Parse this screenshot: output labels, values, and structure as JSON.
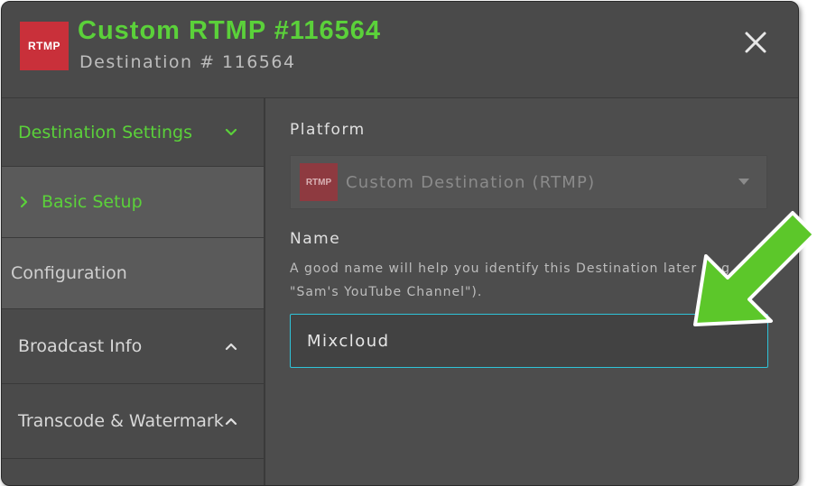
{
  "header": {
    "logo_text": "RTMP",
    "title": "Custom RTMP #116564",
    "subtitle": "Destination # 116564"
  },
  "sidebar": {
    "items": [
      {
        "label": "Destination Settings"
      },
      {
        "label": "Basic Setup"
      },
      {
        "label": "Configuration"
      },
      {
        "label": "Broadcast Info"
      },
      {
        "label": "Transcode & Watermark"
      }
    ]
  },
  "main": {
    "platform_label": "Platform",
    "platform": {
      "logo_text": "RTMP",
      "value": "Custom Destination (RTMP)"
    },
    "name_label": "Name",
    "name_help": "A good name will help you identify this Destination later (e.g. \"Sam's YouTube Channel\").",
    "name_value": "Mixcloud"
  },
  "colors": {
    "accent_green": "#5bd13a",
    "rtmp_red": "#c9303a",
    "input_focus_border": "#2fc3d8",
    "panel_bg": "#4d4d4d",
    "annotation_arrow": "#5cc72a"
  },
  "icons": {
    "close": "close-icon",
    "chevron_down": "chevron-down-icon",
    "chevron_right": "chevron-right-icon",
    "chevron_up": "chevron-up-icon",
    "caret_down": "caret-down-icon",
    "annotation_arrow": "arrow-annotation-icon"
  }
}
